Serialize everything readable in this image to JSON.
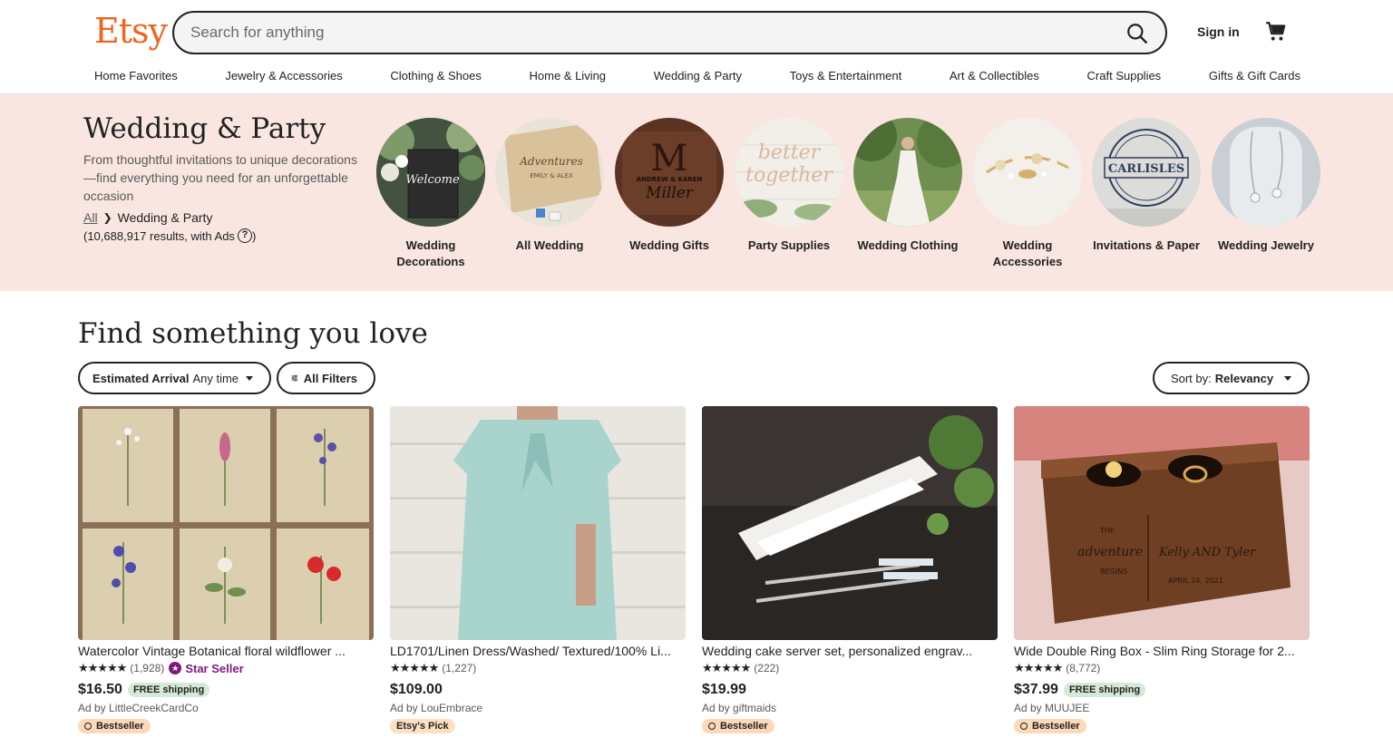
{
  "header": {
    "logo": "Etsy",
    "search_placeholder": "Search for anything",
    "signin": "Sign in",
    "nav": [
      "Home Favorites",
      "Jewelry & Accessories",
      "Clothing & Shoes",
      "Home & Living",
      "Wedding & Party",
      "Toys & Entertainment",
      "Art & Collectibles",
      "Craft Supplies",
      "Gifts & Gift Cards"
    ]
  },
  "hero": {
    "title": "Wedding & Party",
    "description": "From thoughtful invitations to unique decorations—find everything you need for an unforgettable occasion",
    "breadcrumb_all": "All",
    "breadcrumb_current": "Wedding & Party",
    "results_text": "(10,688,917 results, with Ads",
    "results_close": ")",
    "categories": [
      {
        "label": "Wedding Decorations"
      },
      {
        "label": "All Wedding"
      },
      {
        "label": "Wedding Gifts"
      },
      {
        "label": "Party Supplies"
      },
      {
        "label": "Wedding Clothing"
      },
      {
        "label": "Wedding Accessories"
      },
      {
        "label": "Invitations & Paper"
      },
      {
        "label": "Wedding Jewelry"
      }
    ],
    "images": {
      "welcome_text": "Welcome",
      "box_text": "Adventures",
      "box_names": "EMILY & ALEX",
      "board_initial": "M",
      "board_names": "ANDREW & KAREN",
      "board_surname": "Miller",
      "party_text1": "better",
      "party_text2": "together",
      "stamp_text": "CARLISLES"
    }
  },
  "main": {
    "heading": "Find something you love",
    "filter_arrival_label": "Estimated Arrival",
    "filter_arrival_value": "Any time",
    "filter_all": "All Filters",
    "sort_label": "Sort by:",
    "sort_value": "Relevancy"
  },
  "listings": [
    {
      "title": "Watercolor Vintage Botanical floral wildflower ...",
      "stars": "★★★★★",
      "reviews": "(1,928)",
      "star_seller": "Star Seller",
      "price": "$16.50",
      "shipping": "FREE shipping",
      "ad": "Ad by LittleCreekCardCo",
      "tag": "Bestseller"
    },
    {
      "title": "LD1701/Linen Dress/Washed/ Textured/100% Li...",
      "stars": "★★★★★",
      "reviews": "(1,227)",
      "star_seller": "",
      "price": "$109.00",
      "shipping": "",
      "ad": "Ad by LouEmbrace",
      "tag": "Etsy's Pick"
    },
    {
      "title": "Wedding cake server set, personalized engrav...",
      "stars": "★★★★★",
      "reviews": "(222)",
      "star_seller": "",
      "price": "$19.99",
      "shipping": "",
      "ad": "Ad by giftmaids",
      "tag": "Bestseller"
    },
    {
      "title": "Wide Double Ring Box - Slim Ring Storage for 2...",
      "stars": "★★★★★",
      "reviews": "(8,772)",
      "star_seller": "",
      "price": "$37.99",
      "shipping": "FREE shipping",
      "ad": "Ad by MUUJEE",
      "tag": "Bestseller"
    }
  ],
  "listing_images": {
    "ring_box_line1": "THE",
    "ring_box_line2": "adventure",
    "ring_box_line3": "BEGINS",
    "ring_box_names": "Kelly AND Tyler",
    "ring_box_date": "APRIL 24, 2021"
  },
  "colors": {
    "brand": "#f1641e",
    "hero_bg": "#f9e6e1",
    "star_seller": "#7f187f",
    "free_shipping": "#d4e9d7",
    "bestseller": "#fdd8b9"
  }
}
